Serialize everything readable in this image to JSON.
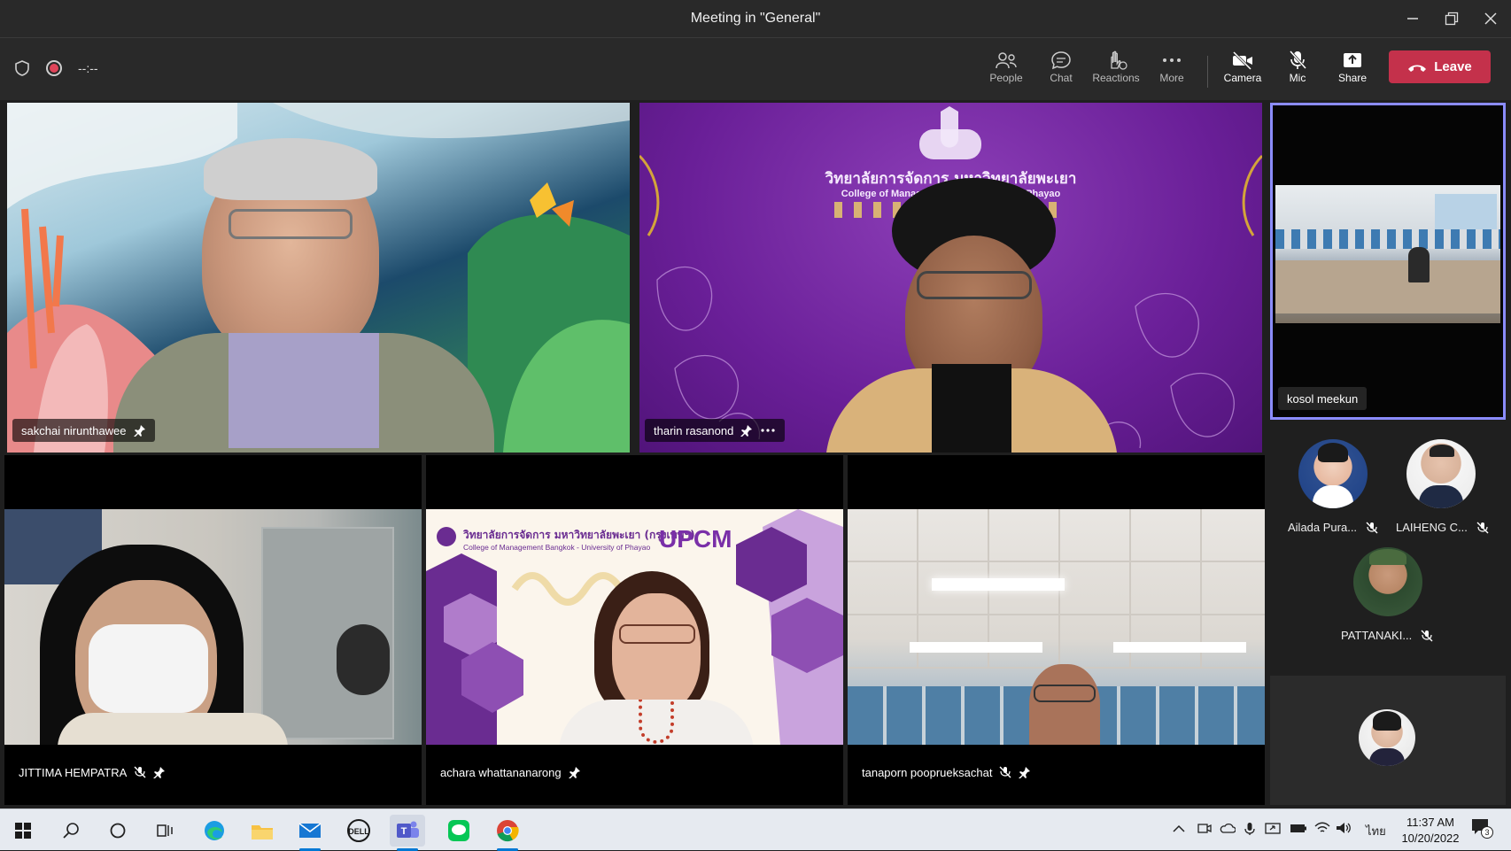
{
  "window": {
    "title": "Meeting in \"General\""
  },
  "toolbar": {
    "timer": "--:--",
    "people_label": "People",
    "chat_label": "Chat",
    "reactions_label": "Reactions",
    "more_label": "More",
    "camera_label": "Camera",
    "mic_label": "Mic",
    "share_label": "Share",
    "leave_label": "Leave"
  },
  "tiles": [
    {
      "name": "sakchai nirunthawee",
      "pinned": true,
      "muted": false
    },
    {
      "name": "tharin rasanond",
      "pinned": true,
      "muted": false
    },
    {
      "name": "kosol meekun",
      "pinned": false,
      "muted": false
    },
    {
      "name": "JITTIMA HEMPATRA",
      "pinned": true,
      "muted": true
    },
    {
      "name": "achara whattananarong",
      "pinned": true,
      "muted": false
    },
    {
      "name": "tanaporn pooprueksachat",
      "pinned": true,
      "muted": true
    }
  ],
  "backgrounds": {
    "tharin_thai": "วิทยาลัยการจัดการ มหาวิทยาลัยพะเยา",
    "tharin_en": "College of Management ... University of Phayao",
    "achara_thai": "วิทยาลัยการจัดการ มหาวิทยาลัยพะเยา (กรุงเทพฯ)",
    "achara_en": "College of Management Bangkok - University of Phayao",
    "achara_brand": "UPCM"
  },
  "side_participants": [
    {
      "name": "Ailada Pura...",
      "muted": true
    },
    {
      "name": "LAIHENG C...",
      "muted": true
    },
    {
      "name": "PATTANAKI...",
      "muted": true
    }
  ],
  "taskbar": {
    "time": "11:37 AM",
    "date": "10/20/2022",
    "lang": "ไทย",
    "notifications": "3"
  },
  "colors": {
    "leave": "#c4314b",
    "active_speaker_border": "#8b8cff",
    "titlebar": "#292929"
  }
}
